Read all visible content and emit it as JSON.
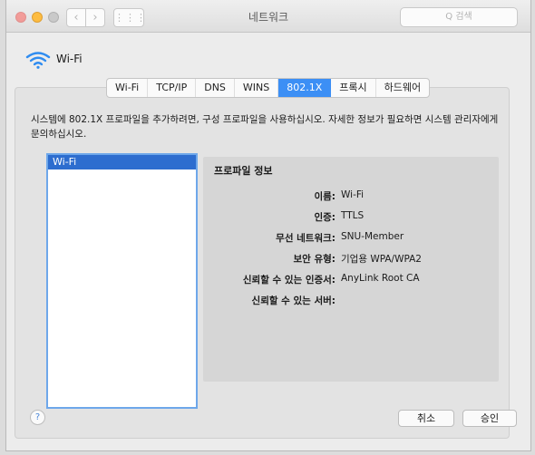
{
  "titlebar": {
    "title": "네트워크",
    "search_placeholder": "Q 검색",
    "back_glyph": "‹",
    "forward_glyph": "›",
    "grid_glyph": "⋮⋮⋮"
  },
  "header": {
    "icon": "wifi-icon",
    "title": "Wi-Fi"
  },
  "tabs": [
    {
      "label": "Wi-Fi"
    },
    {
      "label": "TCP/IP"
    },
    {
      "label": "DNS"
    },
    {
      "label": "WINS"
    },
    {
      "label": "802.1X",
      "active": true
    },
    {
      "label": "프록시"
    },
    {
      "label": "하드웨어"
    }
  ],
  "description": "시스템에 802.1X 프로파일을 추가하려면, 구성 프로파일을 사용하십시오. 자세한 정보가 필요하면 시스템 관리자에게 문의하십시오.",
  "profiles": {
    "items": [
      {
        "label": "Wi-Fi",
        "selected": true
      }
    ]
  },
  "profile_info": {
    "title": "프로파일 정보",
    "rows": [
      {
        "key": "이름:",
        "value": "Wi-Fi"
      },
      {
        "key": "인증:",
        "value": "TTLS"
      },
      {
        "key": "무선 네트워크:",
        "value": "SNU-Member"
      },
      {
        "key": "보안 유형:",
        "value": "기업용 WPA/WPA2"
      },
      {
        "key": "신뢰할 수 있는 인증서:",
        "value": "AnyLink Root CA"
      },
      {
        "key": "신뢰할 수 있는 서버:",
        "value": ""
      }
    ]
  },
  "footer": {
    "help": "?",
    "cancel": "취소",
    "approve": "승인"
  },
  "colors": {
    "accent": "#3c8ff5",
    "selection": "#2d6dcf",
    "wifi": "#2f8cf0"
  }
}
